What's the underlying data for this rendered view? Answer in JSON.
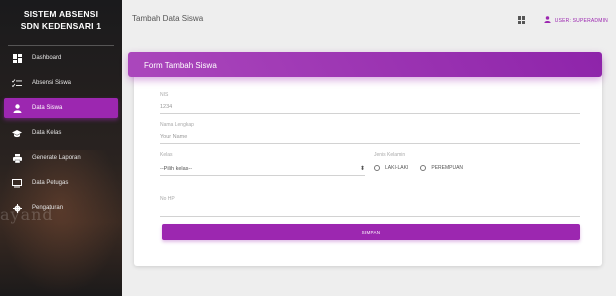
{
  "sidebar": {
    "brand_line1": "SISTEM ABSENSI",
    "brand_line2": "SDN KEDENSARI 1",
    "items": [
      {
        "label": "Dashboard",
        "icon": "dashboard-icon"
      },
      {
        "label": "Absensi Siswa",
        "icon": "list-check-icon"
      },
      {
        "label": "Data Siswa",
        "icon": "person-icon"
      },
      {
        "label": "Data Kelas",
        "icon": "school-icon"
      },
      {
        "label": "Generate Laporan",
        "icon": "print-icon"
      },
      {
        "label": "Data Petugas",
        "icon": "monitor-icon"
      },
      {
        "label": "Pengaturan",
        "icon": "gear-icon"
      }
    ],
    "active_index": 2,
    "watermark": "ayand"
  },
  "topbar": {
    "title": "Tambah Data Siswa",
    "user_label": "USER: SUPERADMIN"
  },
  "form": {
    "header": "Form Tambah Siswa",
    "nis_label": "NIS",
    "nis_value": "1234",
    "nama_label": "Nama Lengkap",
    "nama_value": "Your Name",
    "kelas_label": "Kelas",
    "kelas_selected": "--Pilih kelas--",
    "jk_label": "Jenis Kelamin",
    "jk_options": [
      "LAKI-LAKI",
      "PEREMPUAN"
    ],
    "hp_label": "No HP",
    "submit_label": "SIMPAN"
  },
  "colors": {
    "accent": "#9c27b0"
  }
}
